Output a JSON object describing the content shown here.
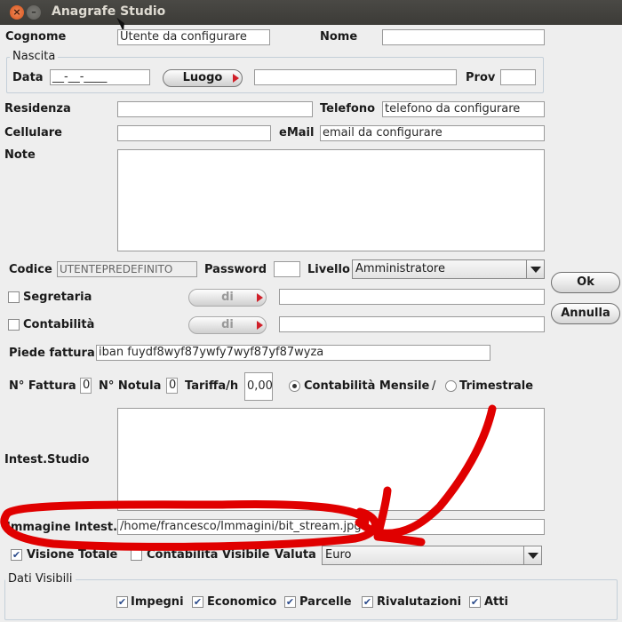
{
  "window": {
    "title": "Anagrafe Studio"
  },
  "fields": {
    "cognome": {
      "label": "Cognome",
      "value": "Utente da configurare"
    },
    "nome": {
      "label": "Nome",
      "value": ""
    },
    "nascita": {
      "group_label": "Nascita",
      "data_label": "Data",
      "data_value": "__-__-____",
      "luogo_button": "Luogo",
      "luogo_value": "",
      "prov_label": "Prov",
      "prov_value": ""
    },
    "residenza": {
      "label": "Residenza",
      "value": ""
    },
    "telefono": {
      "label": "Telefono",
      "value": "telefono da configurare"
    },
    "cellulare": {
      "label": "Cellulare",
      "value": ""
    },
    "email": {
      "label": "eMail",
      "value": "email da configurare"
    },
    "note": {
      "label": "Note",
      "value": ""
    },
    "codice": {
      "label": "Codice",
      "value": "UTENTEPREDEFINITO"
    },
    "password": {
      "label": "Password",
      "value": ""
    },
    "livello": {
      "label": "Livello",
      "value": "Amministratore"
    },
    "segreteria": {
      "label": "Segretaria",
      "checked": false,
      "di_button": "di",
      "value": ""
    },
    "contabilita": {
      "label": "Contabilità",
      "checked": false,
      "di_button": "di",
      "value": ""
    },
    "piede_fattura": {
      "label": "Piede fattura",
      "value": "iban fuydf8wyf87ywfy7wyf87yf87wyza"
    },
    "n_fattura": {
      "label": "N° Fattura",
      "value": "0"
    },
    "n_notula": {
      "label": "N° Notula",
      "value": "0"
    },
    "tariffa": {
      "label": "Tariffa/h",
      "value": "0,00"
    },
    "contabilita_mode": {
      "mensile_label": "Contabilità Mensile",
      "separator": "/",
      "trimestrale_label": "Trimestrale",
      "selected": "mensile"
    },
    "intest_studio": {
      "label": "Intest.Studio",
      "value": ""
    },
    "immagine_intest": {
      "label": "Immagine Intest.",
      "value": "/home/francesco/Immagini/bit_stream.jpg"
    },
    "visione_totale": {
      "label": "Visione Totale",
      "checked": true
    },
    "contabilita_visibile": {
      "label": "Contabilità Visibile",
      "checked": false
    },
    "valuta": {
      "label": "Valuta",
      "value": "Euro"
    }
  },
  "dati_visibili": {
    "group_label": "Dati Visibili",
    "items": [
      {
        "label": "Impegni",
        "checked": true
      },
      {
        "label": "Economico",
        "checked": true
      },
      {
        "label": "Parcelle",
        "checked": true
      },
      {
        "label": "Rivalutazioni",
        "checked": true
      },
      {
        "label": "Atti",
        "checked": true
      }
    ]
  },
  "buttons": {
    "ok": "Ok",
    "annulla": "Annulla"
  },
  "annotation": {
    "color": "#e00000"
  }
}
